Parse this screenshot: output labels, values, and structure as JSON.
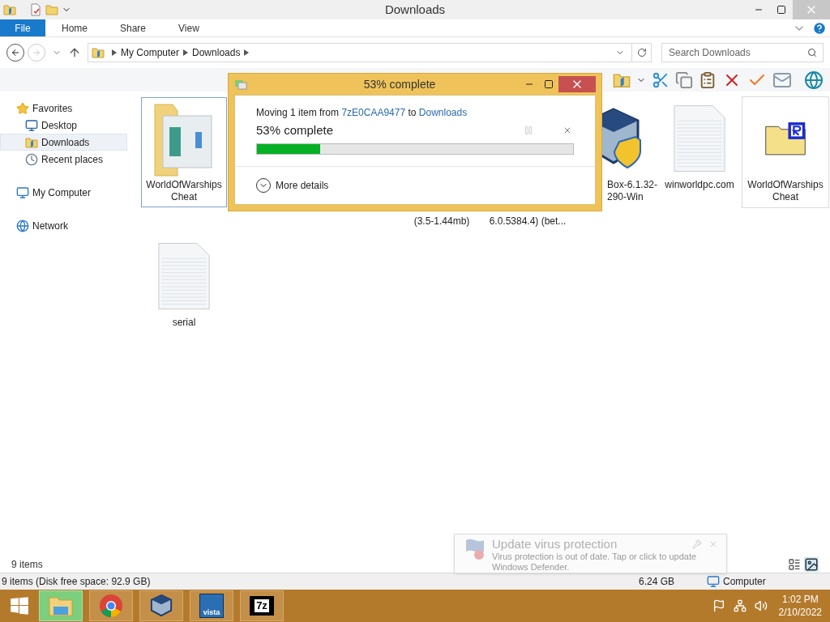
{
  "window": {
    "title": "Downloads"
  },
  "ribbon": {
    "tabs": [
      {
        "label": "File",
        "selected": true
      },
      {
        "label": "Home",
        "selected": false
      },
      {
        "label": "Share",
        "selected": false
      },
      {
        "label": "View",
        "selected": false
      }
    ]
  },
  "address": {
    "path": [
      "My Computer",
      "Downloads"
    ]
  },
  "search": {
    "placeholder": "Search Downloads"
  },
  "sidebar": {
    "groups": [
      {
        "label": "Favorites",
        "kind": "favorites",
        "children": [
          {
            "label": "Desktop",
            "kind": "desktop",
            "selected": false
          },
          {
            "label": "Downloads",
            "kind": "downloads",
            "selected": true
          },
          {
            "label": "Recent places",
            "kind": "recent",
            "selected": false
          }
        ]
      },
      {
        "label": "My Computer",
        "kind": "computer"
      },
      {
        "label": "Network",
        "kind": "network"
      }
    ]
  },
  "files": [
    {
      "kind": "folder-document",
      "lines": [
        "WorldOfWarships",
        "Cheat"
      ],
      "selected": true,
      "hovered": false
    },
    {
      "kind": "hidden"
    },
    {
      "kind": "hidden"
    },
    {
      "kind": "covered",
      "lines": [
        "(3.5-1.44mb)"
      ]
    },
    {
      "kind": "covered",
      "lines": [
        "6.0.5384.4) (bet..."
      ]
    },
    {
      "kind": "virtualbox",
      "lines": [
        "Box-6.1.32-",
        "290-Win"
      ],
      "selected": false,
      "hovered": false
    },
    {
      "kind": "text-file",
      "lines": [
        "winworldpc.com"
      ],
      "selected": false,
      "hovered": false
    },
    {
      "kind": "folder-r",
      "lines": [
        "WorldOfWarships",
        "Cheat"
      ],
      "selected": false,
      "hovered": true
    },
    {
      "kind": "text-file",
      "lines": [
        "serial"
      ],
      "selected": false,
      "hovered": false
    }
  ],
  "item_count": "9 items",
  "status_bar": {
    "summary": "9 items (Disk free space: 92.9 GB)",
    "size": "6.24 GB",
    "location": "Computer"
  },
  "dialog": {
    "title": "53% complete",
    "prefix": "Moving 1 item from",
    "source": "7zE0CAA9477",
    "middle": "to",
    "destination": "Downloads",
    "status": "53% complete",
    "level": 0.2,
    "pause_disabled": true,
    "more_details": "More details"
  },
  "toast": {
    "title": "Update virus protection",
    "body": "Virus protection is out of date. Tap or click to update Windows Defender."
  },
  "taskbar": {
    "apps": [
      {
        "kind": "explorer",
        "selected": true
      },
      {
        "kind": "chrome",
        "selected": false
      },
      {
        "kind": "virtualbox",
        "selected": false
      },
      {
        "kind": "vista",
        "label": "vista",
        "selected": false
      },
      {
        "kind": "archiver",
        "label": "7z",
        "selected": false
      }
    ],
    "time": "1:02 PM",
    "date": "2/10/2022"
  }
}
